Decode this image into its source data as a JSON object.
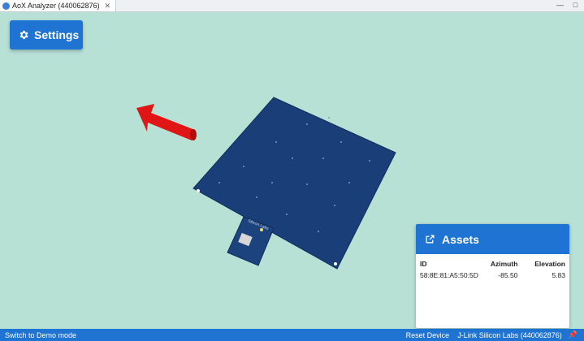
{
  "window": {
    "tab_title": "AoX Analyzer (440062876)",
    "tab_close": "✕",
    "minimize": "—",
    "maximize": "□"
  },
  "settings": {
    "label": "Settings"
  },
  "scene": {
    "board_label": "Silicon Labs",
    "board_color": "#1a3f78",
    "arrow_color": "#e01515"
  },
  "assets": {
    "title": "Assets",
    "columns": [
      "ID",
      "Azimuth",
      "Elevation"
    ],
    "rows": [
      {
        "id": "58:8E:81:A5:50:5D",
        "azimuth": "-85.50",
        "elevation": "5.83"
      }
    ]
  },
  "status": {
    "left": "Switch to Demo mode",
    "reset": "Reset Device",
    "device": "J-Link Silicon Labs (440062876)"
  },
  "colors": {
    "accent": "#1e73d3",
    "background": "#b8e1d6"
  }
}
